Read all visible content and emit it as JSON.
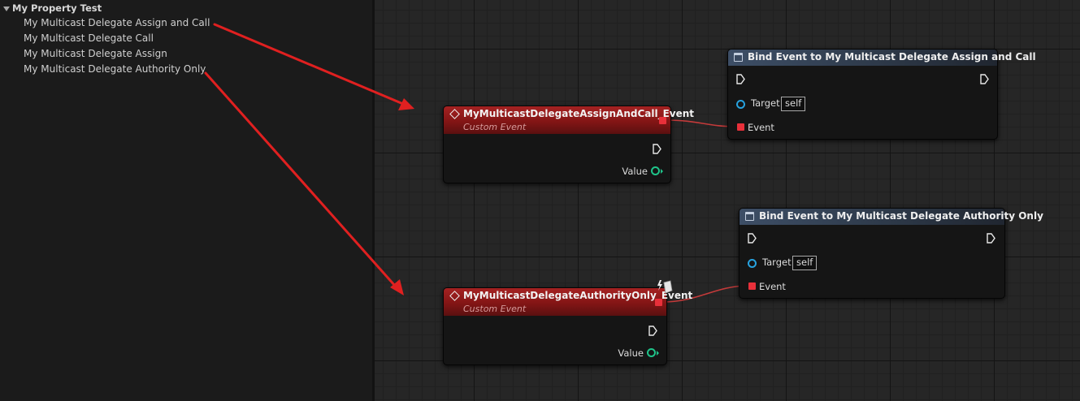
{
  "panel": {
    "category": "My Property Test",
    "items": [
      "My Multicast Delegate Assign and Call",
      "My Multicast Delegate Call",
      "My Multicast Delegate Assign",
      "My Multicast Delegate Authority Only"
    ]
  },
  "nodes": {
    "event1": {
      "title": "MyMulticastDelegateAssignAndCall_Event",
      "subtitle": "Custom Event",
      "value_label": "Value"
    },
    "event2": {
      "title": "MyMulticastDelegateAuthorityOnly_Event",
      "subtitle": "Custom Event",
      "value_label": "Value"
    },
    "bind1": {
      "title": "Bind Event to My Multicast Delegate Assign and Call",
      "target_label": "Target",
      "target_value": "self",
      "event_label": "Event"
    },
    "bind2": {
      "title": "Bind Event to My Multicast Delegate Authority Only",
      "target_label": "Target",
      "target_value": "self",
      "event_label": "Event"
    }
  },
  "colors": {
    "event_header": "#a52222",
    "function_header": "#3d4e66",
    "delegate_pin": "#e8303a",
    "object_pin": "#27a3e0",
    "value_pin": "#1fc48a",
    "annotation_arrow": "#e02020",
    "wire": "#c43a3a"
  },
  "icons": {
    "event": "diamond-icon",
    "function": "function-icon",
    "replication": "lightning-box-icon"
  }
}
